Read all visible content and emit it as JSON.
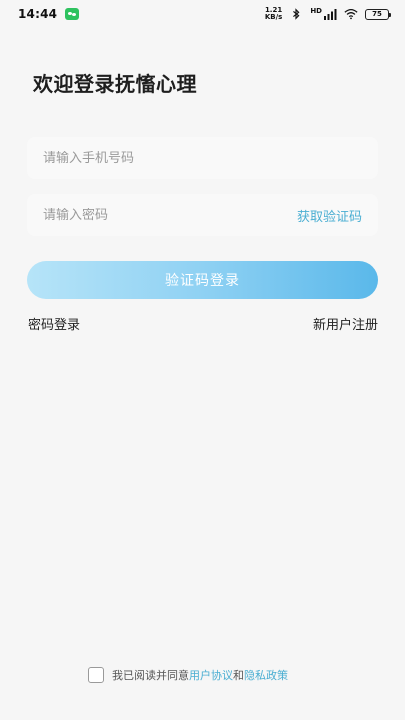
{
  "status_bar": {
    "time": "14:44",
    "net_speed_value": "1.21",
    "net_speed_unit": "KB/s",
    "signal_label": "HD",
    "battery": "75"
  },
  "login": {
    "title": "欢迎登录抚慉心理",
    "phone_placeholder": "请输入手机号码",
    "password_placeholder": "请输入密码",
    "get_code_label": "获取验证码",
    "submit_label": "验证码登录",
    "password_login_label": "密码登录",
    "register_label": "新用户注册"
  },
  "agreement": {
    "prefix": "我已阅读并同意",
    "user_agreement": "用户协议",
    "and": "和",
    "privacy_policy": "隐私政策"
  },
  "colors": {
    "accent": "#4aaed2",
    "button_start": "#b6e4f8",
    "button_end": "#5ab8ea",
    "background": "#f6f6f6"
  }
}
